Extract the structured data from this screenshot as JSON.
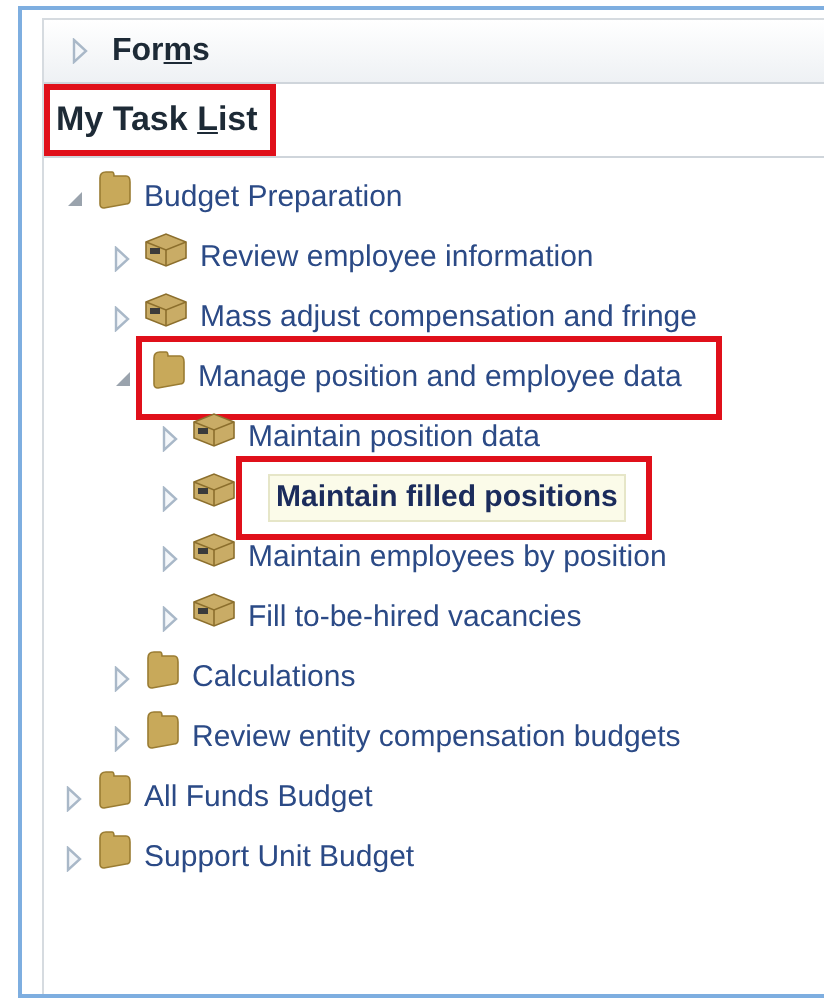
{
  "forms_header": {
    "segments": [
      {
        "text": "For",
        "underlined": false
      },
      {
        "text": "m",
        "underlined": true
      },
      {
        "text": "s",
        "underlined": false
      }
    ],
    "expanded": false
  },
  "task_list_header": {
    "segments": [
      {
        "text": "My Task ",
        "underlined": false
      },
      {
        "text": "L",
        "underlined": true
      },
      {
        "text": "ist",
        "underlined": false
      }
    ],
    "highlighted": true
  },
  "tree": [
    {
      "label": "Budget Preparation",
      "kind": "folder",
      "expanded": true,
      "selected": false,
      "highlighted": false,
      "children": [
        {
          "label": "Review employee information",
          "kind": "task",
          "expanded": false,
          "selected": false,
          "highlighted": false
        },
        {
          "label": "Mass adjust compensation and fringe",
          "kind": "task",
          "expanded": false,
          "selected": false,
          "highlighted": false
        },
        {
          "label": "Manage position and employee data",
          "kind": "folder",
          "expanded": true,
          "selected": false,
          "highlighted": true,
          "children": [
            {
              "label": "Maintain position data",
              "kind": "task",
              "expanded": false,
              "selected": false,
              "highlighted": false
            },
            {
              "label": "Maintain filled positions",
              "kind": "task",
              "expanded": false,
              "selected": true,
              "highlighted": true
            },
            {
              "label": "Maintain employees by position",
              "kind": "task",
              "expanded": false,
              "selected": false,
              "highlighted": false
            },
            {
              "label": "Fill to-be-hired vacancies",
              "kind": "task",
              "expanded": false,
              "selected": false,
              "highlighted": false
            }
          ]
        },
        {
          "label": "Calculations",
          "kind": "folder",
          "expanded": false,
          "selected": false,
          "highlighted": false
        },
        {
          "label": "Review entity compensation budgets",
          "kind": "folder",
          "expanded": false,
          "selected": false,
          "highlighted": false
        }
      ]
    },
    {
      "label": "All Funds Budget",
      "kind": "folder",
      "expanded": false,
      "selected": false,
      "highlighted": false
    },
    {
      "label": "Support Unit Budget",
      "kind": "folder",
      "expanded": false,
      "selected": false,
      "highlighted": false
    }
  ]
}
